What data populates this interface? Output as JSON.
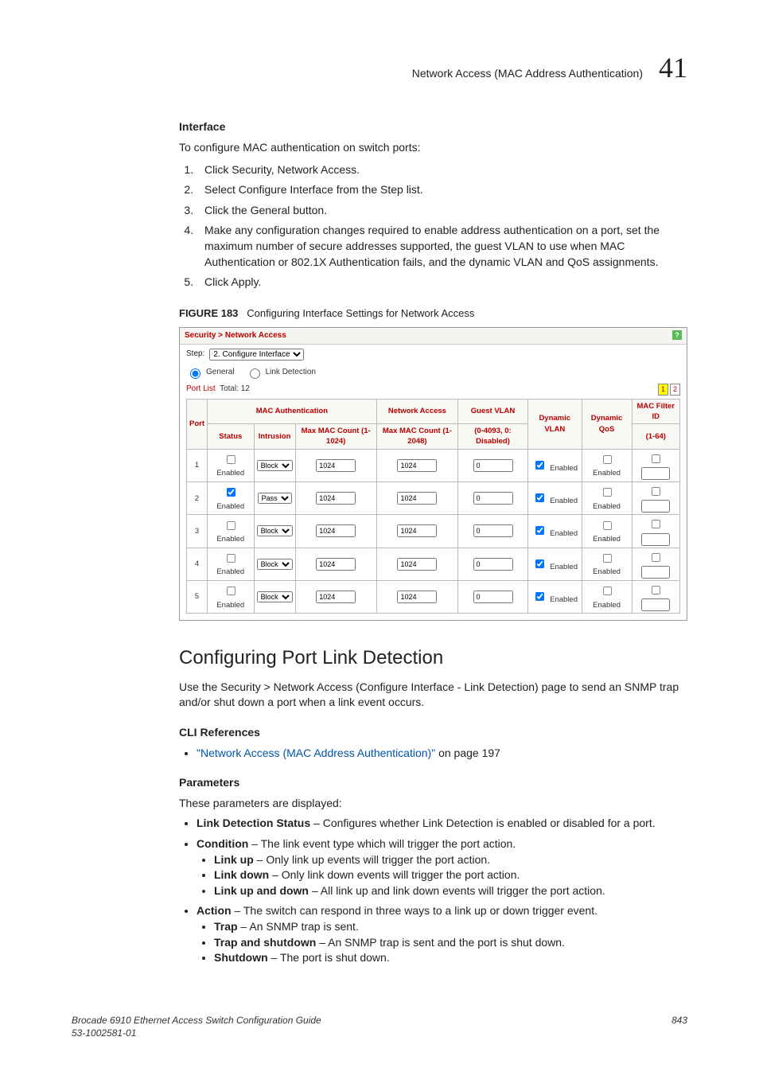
{
  "header": {
    "running_title": "Network Access (MAC Address Authentication)",
    "chapter_number": "41"
  },
  "interface_section": {
    "heading": "Interface",
    "intro": "To configure MAC authentication on switch ports:",
    "steps": [
      "Click Security, Network Access.",
      "Select Configure Interface from the Step list.",
      "Click the General button.",
      "Make any configuration changes required to enable address authentication on a port, set the maximum number of secure addresses supported, the guest VLAN to use when MAC Authentication or 802.1X Authentication fails, and the dynamic VLAN and QoS assignments.",
      "Click Apply."
    ],
    "figure_label": "FIGURE 183",
    "figure_caption": "Configuring Interface Settings for Network Access"
  },
  "screenshot": {
    "breadcrumb": "Security > Network Access",
    "step_label": "Step:",
    "step_value": "2. Configure Interface",
    "radio_general": "General",
    "radio_linkdetect": "Link Detection",
    "portlist_label": "Port List",
    "portlist_total_label": "Total:",
    "portlist_total": "12",
    "pager": [
      "1",
      "2"
    ],
    "columns": {
      "port": "Port",
      "mac_auth": "MAC Authentication",
      "status": "Status",
      "intrusion": "Intrusion",
      "max_mac": "Max MAC Count (1-1024)",
      "net_access": "Network Access",
      "net_access_sub": "Max MAC Count (1-2048)",
      "guest_vlan": "Guest VLAN",
      "guest_vlan_sub": "(0-4093, 0: Disabled)",
      "dyn_vlan": "Dynamic VLAN",
      "dyn_qos": "Dynamic QoS",
      "mac_filter": "MAC Filter ID",
      "mac_filter_sub": "(1-64)"
    },
    "enabled_label": "Enabled",
    "rows": [
      {
        "port": "1",
        "status": false,
        "intrusion": "Block",
        "maxmac": "1024",
        "netmax": "1024",
        "guest": "0",
        "dynvlan": true,
        "dynqos": false,
        "filter_chk": false,
        "filter": ""
      },
      {
        "port": "2",
        "status": true,
        "intrusion": "Pass",
        "maxmac": "1024",
        "netmax": "1024",
        "guest": "0",
        "dynvlan": true,
        "dynqos": false,
        "filter_chk": false,
        "filter": ""
      },
      {
        "port": "3",
        "status": false,
        "intrusion": "Block",
        "maxmac": "1024",
        "netmax": "1024",
        "guest": "0",
        "dynvlan": true,
        "dynqos": false,
        "filter_chk": false,
        "filter": ""
      },
      {
        "port": "4",
        "status": false,
        "intrusion": "Block",
        "maxmac": "1024",
        "netmax": "1024",
        "guest": "0",
        "dynvlan": true,
        "dynqos": false,
        "filter_chk": false,
        "filter": ""
      },
      {
        "port": "5",
        "status": false,
        "intrusion": "Block",
        "maxmac": "1024",
        "netmax": "1024",
        "guest": "0",
        "dynvlan": true,
        "dynqos": false,
        "filter_chk": false,
        "filter": ""
      }
    ]
  },
  "link_detection_section": {
    "heading": "Configuring Port Link Detection",
    "intro": "Use the Security > Network Access (Configure Interface - Link Detection) page to send an SNMP trap and/or shut down a port when a link event occurs.",
    "cli_heading": "CLI References",
    "cli_link_text": "\"Network Access (MAC Address Authentication)\"",
    "cli_link_suffix": " on page 197",
    "params_heading": "Parameters",
    "params_intro": "These parameters are displayed:",
    "params": {
      "link_detection_status": {
        "term": "Link Detection Status",
        "desc": " – Configures whether Link Detection is enabled or disabled for a port."
      },
      "condition": {
        "term": "Condition",
        "desc": " – The link event type which will trigger the port action.",
        "sub": [
          {
            "term": "Link up",
            "desc": " – Only link up events will trigger the port action."
          },
          {
            "term": "Link down",
            "desc": " – Only link down events will trigger the port action."
          },
          {
            "term": "Link up and down",
            "desc": " – All link up and link down events will trigger the port action."
          }
        ]
      },
      "action": {
        "term": "Action",
        "desc": " – The switch can respond in three ways to a link up or down trigger event.",
        "sub": [
          {
            "term": "Trap",
            "desc": " – An SNMP trap is sent."
          },
          {
            "term": "Trap and shutdown",
            "desc": " – An SNMP trap is sent and the port is shut down."
          },
          {
            "term": "Shutdown",
            "desc": " – The port is shut down."
          }
        ]
      }
    }
  },
  "footer": {
    "left_line1": "Brocade 6910 Ethernet Access Switch Configuration Guide",
    "left_line2": "53-1002581-01",
    "right": "843"
  }
}
